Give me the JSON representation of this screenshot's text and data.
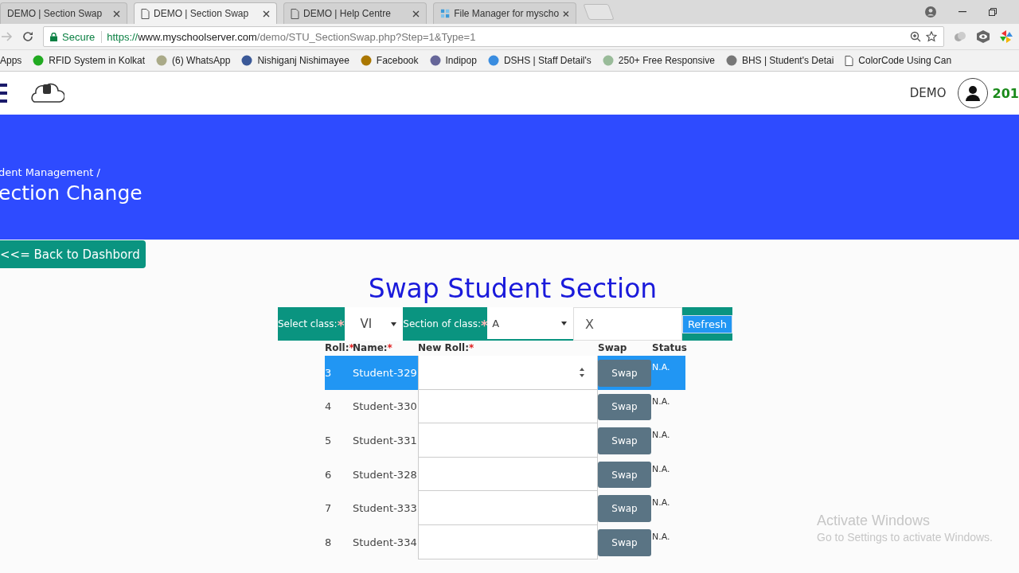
{
  "browser": {
    "tabs": [
      {
        "label": "DEMO | Section Swap",
        "selected": false,
        "kind": "none"
      },
      {
        "label": "DEMO | Section Swap",
        "selected": true,
        "kind": "page"
      },
      {
        "label": "DEMO | Help Centre",
        "selected": false,
        "kind": "page"
      },
      {
        "label": "File Manager for myscho",
        "selected": false,
        "kind": "app"
      }
    ],
    "secure_label": "Secure",
    "url": {
      "scheme": "https://",
      "host": "www.myschoolserver.com",
      "path": "/demo/STU_SectionSwap.php?Step=1&Type=1"
    },
    "bookmarks": [
      {
        "label": "Apps",
        "kind": "none"
      },
      {
        "label": "RFID System in Kolkat",
        "kind": "site"
      },
      {
        "label": "(6) WhatsApp",
        "kind": "site"
      },
      {
        "label": "Nishiganj Nishimayee",
        "kind": "site"
      },
      {
        "label": "Facebook",
        "kind": "site"
      },
      {
        "label": "Indipop",
        "kind": "site"
      },
      {
        "label": "DSHS | Staff Detail's",
        "kind": "site"
      },
      {
        "label": "250+ Free Responsive",
        "kind": "site"
      },
      {
        "label": "BHS | Student's Detai",
        "kind": "site"
      },
      {
        "label": "ColorCode Using Can",
        "kind": "page"
      }
    ]
  },
  "header": {
    "user": "DEMO",
    "year": "201"
  },
  "banner": {
    "breadcrumb": "dent Management /",
    "title": "ection Change"
  },
  "back_button": "<<= Back to Dashbord",
  "title": "Swap Student Section",
  "filters": {
    "class_label": "Select class:",
    "class_mark": "*",
    "class_value": "VI",
    "section_label": "Section of class:",
    "section_mark": "*",
    "section_value": "A",
    "target_value": "X",
    "refresh": "Refresh"
  },
  "table": {
    "columns": [
      {
        "label": "Roll:",
        "mark": "*"
      },
      {
        "label": "Name:",
        "mark": "*"
      },
      {
        "label": "New Roll:",
        "mark": "*"
      },
      {
        "label": "Swap"
      },
      {
        "label": "Status"
      }
    ],
    "rows": [
      {
        "roll": "3",
        "name": "Student-329",
        "action": "Swap",
        "status": "N.A.",
        "selected": true
      },
      {
        "roll": "4",
        "name": "Student-330",
        "action": "Swap",
        "status": "N.A.",
        "selected": false
      },
      {
        "roll": "5",
        "name": "Student-331",
        "action": "Swap",
        "status": "N.A.",
        "selected": false
      },
      {
        "roll": "6",
        "name": "Student-328",
        "action": "Swap",
        "status": "N.A.",
        "selected": false
      },
      {
        "roll": "7",
        "name": "Student-333",
        "action": "Swap",
        "status": "N.A.",
        "selected": false
      },
      {
        "roll": "8",
        "name": "Student-334",
        "action": "Swap",
        "status": "N.A.",
        "selected": false
      }
    ]
  },
  "os_notice": {
    "title": "Activate Windows",
    "subtitle": "Go to Settings to activate Windows."
  }
}
